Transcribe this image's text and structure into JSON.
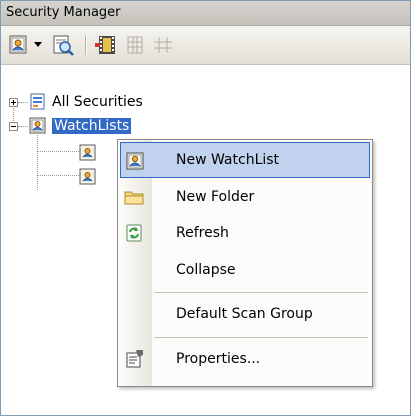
{
  "window": {
    "title": "Security Manager"
  },
  "toolbar": {
    "buttons": [
      {
        "icon": "watchlist-icon"
      },
      {
        "icon": "dropdown-arrow-icon"
      },
      {
        "icon": "scan-icon"
      },
      {
        "icon": "film-icon"
      },
      {
        "icon": "disabled-grid-icon"
      },
      {
        "icon": "disabled-grid-icon-2"
      }
    ]
  },
  "tree": {
    "nodes": [
      {
        "label": "All Securities",
        "icon": "securities-list-icon",
        "expanded": false
      },
      {
        "label": "WatchLists",
        "icon": "watchlist-icon",
        "expanded": true,
        "selected": true
      }
    ]
  },
  "context_menu": {
    "items": [
      {
        "label": "New WatchList",
        "icon": "watchlist-icon",
        "highlighted": true
      },
      {
        "label": "New Folder",
        "icon": "folder-icon"
      },
      {
        "label": "Refresh",
        "icon": "refresh-icon"
      },
      {
        "label": "Collapse",
        "icon": ""
      },
      {
        "label": "Default Scan Group",
        "icon": ""
      },
      {
        "label": "Properties...",
        "icon": "properties-icon"
      }
    ]
  },
  "colors": {
    "selection": "#316ac5",
    "menu_highlight": "#c1d2ee"
  }
}
